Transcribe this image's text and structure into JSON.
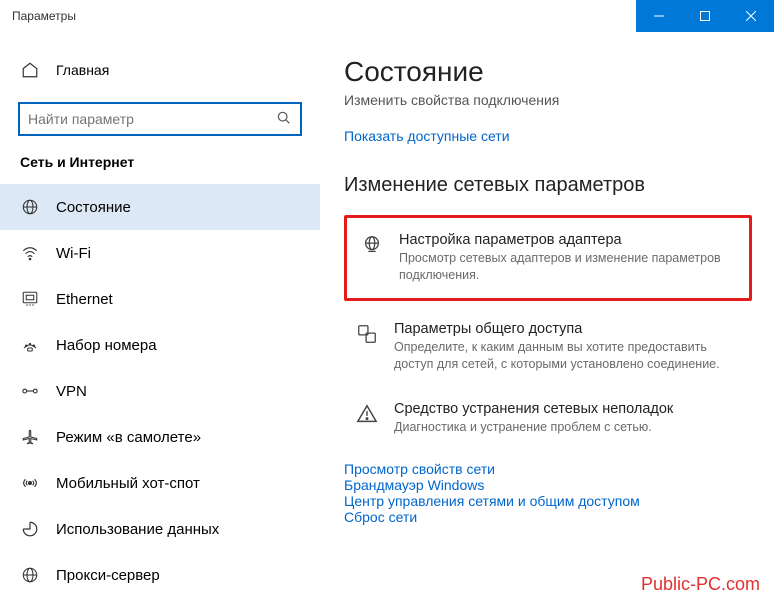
{
  "titlebar": {
    "title": "Параметры"
  },
  "sidebar": {
    "home_label": "Главная",
    "search_placeholder": "Найти параметр",
    "category": "Сеть и Интернет",
    "items": [
      {
        "label": "Состояние"
      },
      {
        "label": "Wi-Fi"
      },
      {
        "label": "Ethernet"
      },
      {
        "label": "Набор номера"
      },
      {
        "label": "VPN"
      },
      {
        "label": "Режим «в самолете»"
      },
      {
        "label": "Мобильный хот-спот"
      },
      {
        "label": "Использование данных"
      },
      {
        "label": "Прокси-сервер"
      }
    ]
  },
  "content": {
    "title": "Состояние",
    "subline": "Изменить свойства подключения",
    "link_networks": "Показать доступные сети",
    "section_title": "Изменение сетевых параметров",
    "cards": [
      {
        "title": "Настройка параметров адаптера",
        "desc": "Просмотр сетевых адаптеров и изменение параметров подключения."
      },
      {
        "title": "Параметры общего доступа",
        "desc": "Определите, к каким данным вы хотите предоставить доступ для сетей, с которыми установлено соединение."
      },
      {
        "title": "Средство устранения сетевых неполадок",
        "desc": "Диагностика и устранение проблем с сетью."
      }
    ],
    "links": [
      "Просмотр свойств сети",
      "Брандмауэр Windows",
      "Центр управления сетями и общим доступом",
      "Сброс сети"
    ]
  },
  "watermark": "Public-PC.com"
}
